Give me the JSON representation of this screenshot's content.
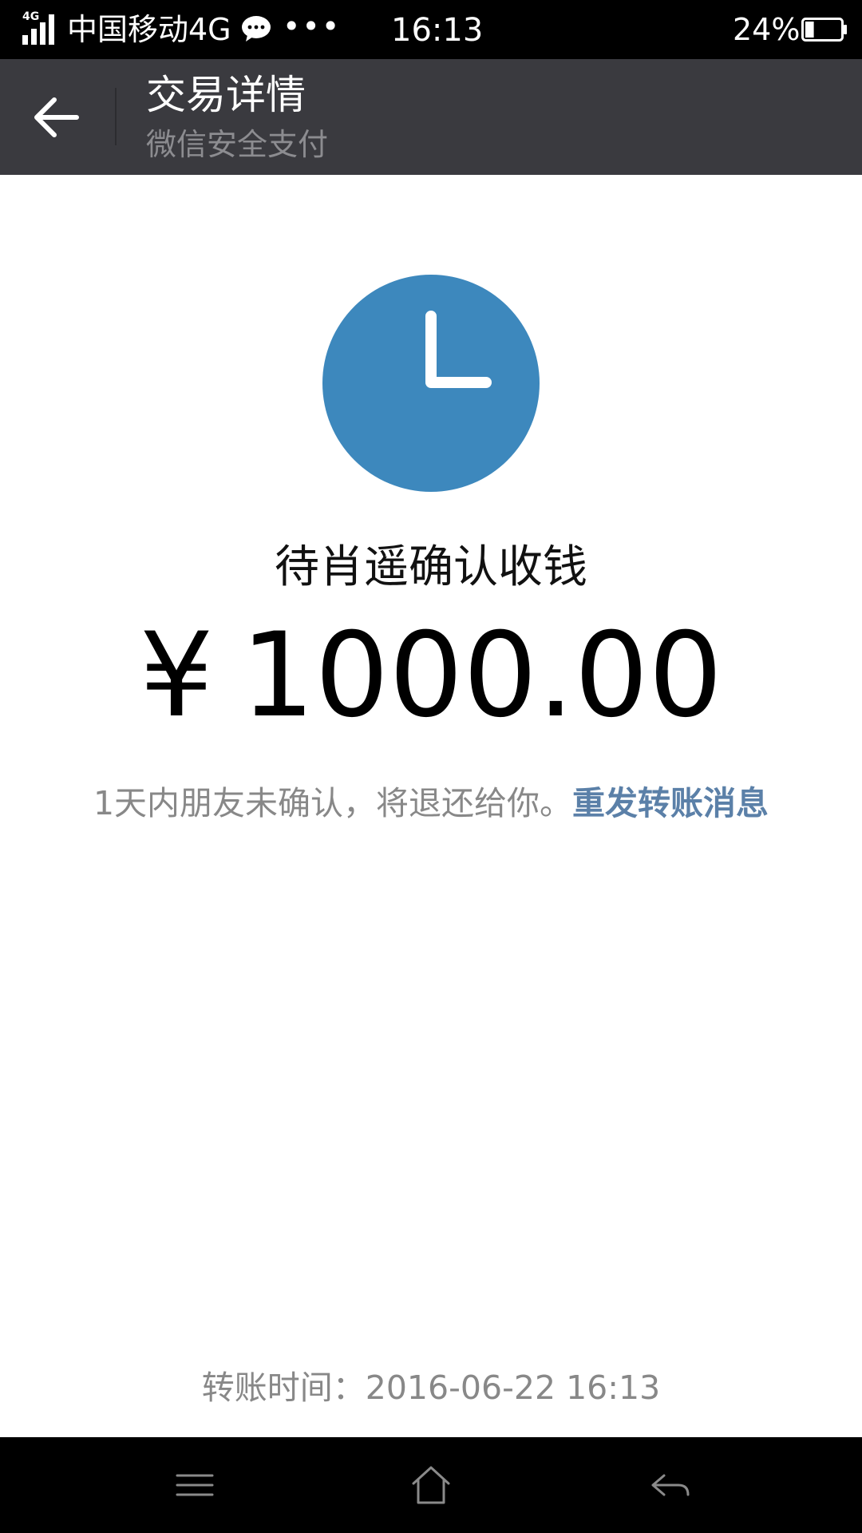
{
  "status_bar": {
    "network_small": "4G",
    "carrier": "中国移动4G",
    "overflow": "•••",
    "time": "16:13",
    "battery": "24%",
    "battery_level": 0.24,
    "icons": [
      "signal-icon",
      "wechat-notification-icon",
      "battery-icon"
    ]
  },
  "header": {
    "title": "交易详情",
    "subtitle": "微信安全支付",
    "back_icon": "arrow-left-icon"
  },
  "transaction": {
    "status_icon": "clock-icon",
    "status_text": "待肖遥确认收钱",
    "currency": "¥",
    "amount": "1000.00",
    "note": "1天内朋友未确认，将退还给你。",
    "resend_label": "重发转账消息",
    "transfer_time_label": "转账时间：",
    "transfer_time": "2016-06-22 16:13"
  },
  "nav_bar": {
    "icons": [
      "menu-icon",
      "home-icon",
      "back-icon"
    ]
  },
  "colors": {
    "status_bar_bg": "#000000",
    "title_bar_bg": "#3a3a3f",
    "clock_blue": "#3d88bd",
    "link": "#5b80a8",
    "muted_text": "#888888"
  }
}
